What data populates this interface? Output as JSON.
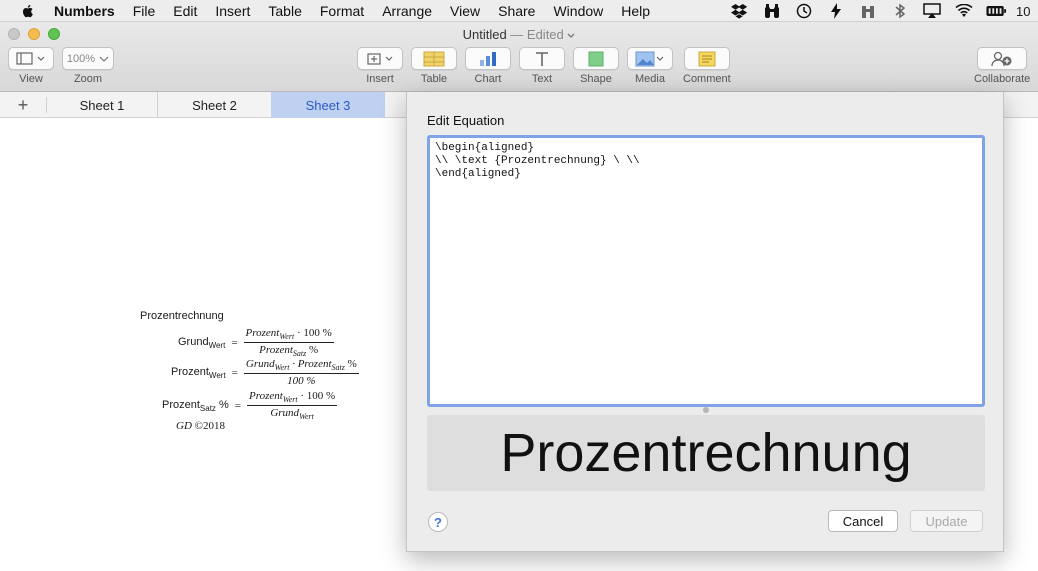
{
  "menubar": {
    "app_name": "Numbers",
    "items": [
      "File",
      "Edit",
      "Insert",
      "Table",
      "Format",
      "Arrange",
      "View",
      "Share",
      "Window",
      "Help"
    ],
    "clock": "10"
  },
  "window": {
    "title": "Untitled",
    "title_state": "— Edited"
  },
  "toolbar": {
    "view_label": "View",
    "zoom_value": "100%",
    "zoom_label": "Zoom",
    "insert_label": "Insert",
    "table_label": "Table",
    "chart_label": "Chart",
    "text_label": "Text",
    "shape_label": "Shape",
    "media_label": "Media",
    "comment_label": "Comment",
    "collaborate_label": "Collaborate"
  },
  "tabs": {
    "add_symbol": "+",
    "sheets": [
      "Sheet 1",
      "Sheet 2",
      "Sheet 3"
    ],
    "active_sheet": "Sheet 3"
  },
  "canvas_equation": {
    "title": "Prozentrechnung",
    "row1": {
      "lhs": "Grund",
      "lhs_sub": "Wert",
      "num_main": "Prozent",
      "num_sub": "Wert",
      "num_tail": " · 100 %",
      "den_main": "Prozent",
      "den_sub": "Satz",
      "den_tail": " %"
    },
    "row2": {
      "lhs": "Prozent",
      "lhs_sub": "Wert",
      "num_main": "Grund",
      "num_sub": "Wert",
      "num_mid": " · Prozent",
      "num_sub2": "Satz",
      "num_tail": " %",
      "den": "100 %"
    },
    "row3": {
      "lhs": "Prozent",
      "lhs_sub": "Satz",
      "lhs_tail": " %",
      "num_main": "Prozent",
      "num_sub": "Wert",
      "num_tail": " · 100 %",
      "den_main": "Grund",
      "den_sub": "Wert"
    },
    "equals": "=",
    "credit_initials": "GD",
    "credit_year": "©2018"
  },
  "dialog": {
    "title": "Edit Equation",
    "latex": "\\begin{aligned}\n\\\\ \\text {Prozentrechnung} \\ \\\\\n\\end{aligned}",
    "preview": "Prozentrechnung",
    "help": "?",
    "cancel_label": "Cancel",
    "update_label": "Update"
  },
  "colors": {
    "accent": "#3c72d8",
    "active_tab_bg": "#bfd0f0",
    "editor_focus_ring": "#7fa3e6"
  }
}
